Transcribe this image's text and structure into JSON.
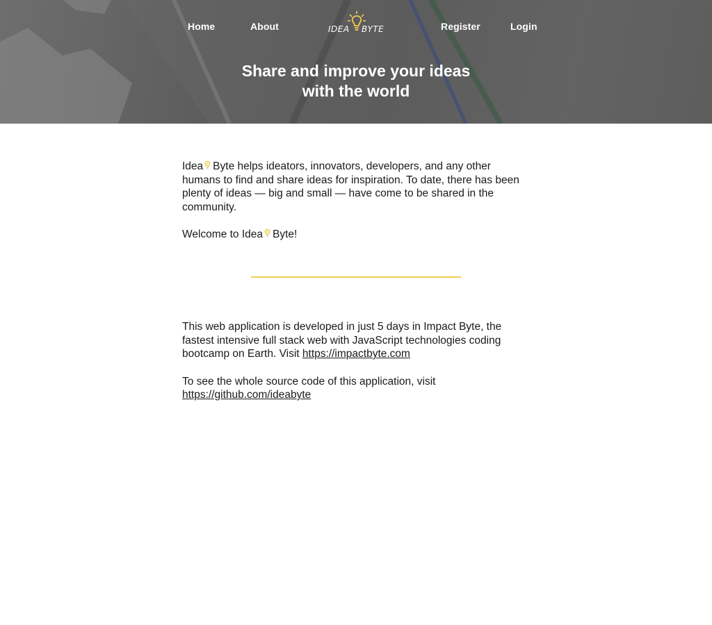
{
  "nav": {
    "home": "Home",
    "about": "About",
    "register": "Register",
    "login": "Login",
    "logo": {
      "left_text": "IDEA",
      "right_text": "BYTE",
      "icon": "lightbulb-icon"
    }
  },
  "hero": {
    "title_line1": "Share and improve your ideas",
    "title_line2": "with the world"
  },
  "intro": {
    "p1_prefix": "Idea",
    "p1_suffix": "Byte helps ideators, innovators, developers, and any other humans to find and share ideas for inspiration. To date, there has been plenty of ideas — big and small — have come to be shared in the community.",
    "p2_prefix": "Welcome to Idea",
    "p2_suffix": "Byte!"
  },
  "about": {
    "p1_text": "This web application is developed in just 5 days in Impact Byte, the fastest intensive full stack web with JavaScript technologies coding bootcamp on Earth. Visit ",
    "p1_link": "https://impactbyte.com",
    "p2_text": "To see the whole source code of this application, visit ",
    "p2_link": "https://github.com/ideabyte"
  },
  "colors": {
    "accent": "#f2cc52",
    "hero_overlay": "#5e5e5e",
    "text": "#1a1a1a"
  }
}
